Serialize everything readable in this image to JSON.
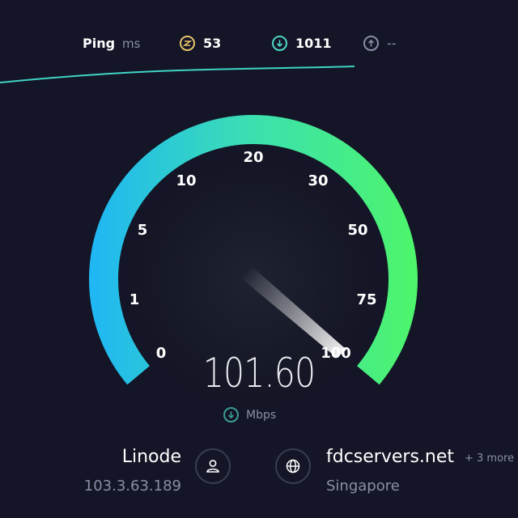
{
  "header": {
    "ping_label": "Ping",
    "ping_unit": "ms",
    "jitter_value": "53",
    "download_value": "1011",
    "upload_value": "--"
  },
  "gauge": {
    "tick_labels": [
      "0",
      "1",
      "5",
      "10",
      "20",
      "30",
      "50",
      "75",
      "100"
    ],
    "speed": "101.60",
    "unit": "Mbps",
    "colors": {
      "start": "#1fb6f5",
      "end": "#4ef56a",
      "track": "#22243a"
    }
  },
  "isp": {
    "name": "Linode",
    "ip": "103.3.63.189"
  },
  "server": {
    "name": "fdcservers.net",
    "more": "+ 3 more",
    "location": "Singapore"
  }
}
